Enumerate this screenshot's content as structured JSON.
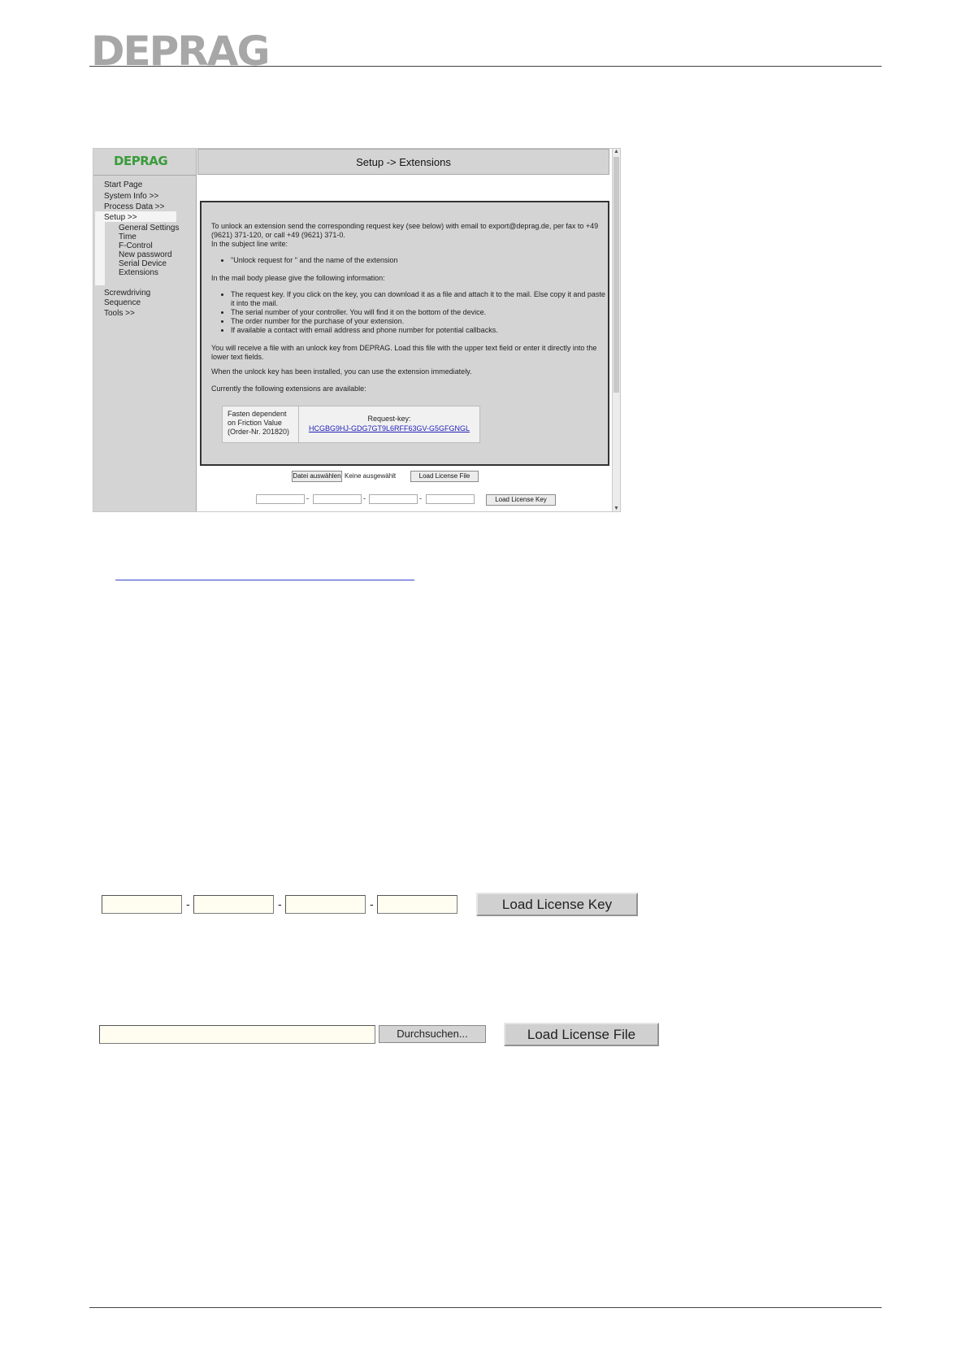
{
  "header": {
    "logo_text": "DEPRAG"
  },
  "screenshot": {
    "logo_text": "DEPRAG",
    "title": "Setup -> Extensions",
    "nav": {
      "start_page": "Start Page",
      "system_info": "System Info >>",
      "process_data": "Process Data >>",
      "setup": "Setup >>",
      "sub": [
        "General Settings",
        "Time",
        "F-Control",
        "New password",
        "Serial Device",
        "Extensions"
      ],
      "screwdriving": "Screwdriving",
      "sequence": "Sequence",
      "tools": "Tools >>"
    },
    "info": {
      "intro": "To unlock an extension send the corresponding request key (see below) with email to export@deprag.de, per fax to +49 (9621) 371-120, or call +49 (9621) 371-0.",
      "subject_intro": "In the subject line write:",
      "subject_items": [
        "\"Unlock request for \" and the name of the extension"
      ],
      "body_intro": "In the mail body please give the following information:",
      "body_items": [
        "The request key. If you click on the key, you can download it as a file and attach it to the mail. Else copy it and paste it into the mail.",
        "The serial number of your controller. You will find it on the bottom of the device.",
        "The order number for the purchase of your extension.",
        "If available a contact with email address and phone number for potential callbacks."
      ],
      "receive": "You will receive a file with an unlock key from DEPRAG. Load this file with the upper text field or enter it directly into the lower text fields.",
      "installed": "When the unlock key has been installed, you can use the extension immediately.",
      "available": "Currently the following extensions are available:"
    },
    "extension": {
      "name_lines": [
        "Fasten dependent",
        "on Friction Value",
        "(Order-Nr. 201820)"
      ],
      "key_label": "Request-key:",
      "key": "HCGBG9HJ-GDG7GT9L6RFF63GV-G5GFGNGL"
    },
    "choose_file_button": "Datei auswählen",
    "no_file_text": "Keine ausgewählt",
    "load_file_button": "Load License File",
    "load_key_button": "Load License Key"
  },
  "license_key_form": {
    "fields": [
      "",
      "",
      "",
      ""
    ],
    "separator": "-",
    "button": "Load License Key"
  },
  "license_file_form": {
    "path_value": "",
    "browse_button": "Durchsuchen...",
    "button": "Load License File"
  }
}
